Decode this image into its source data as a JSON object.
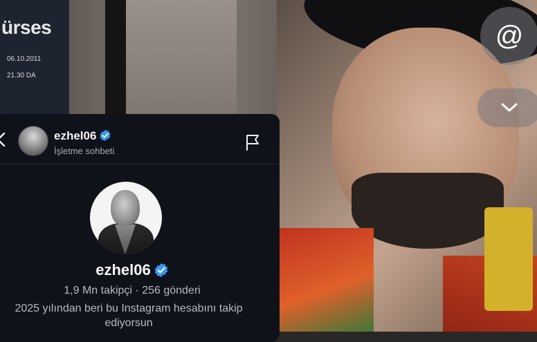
{
  "background": {
    "sign_text": "ürses",
    "sign_date": "06.10.2011",
    "sign_time": "21.30 DA"
  },
  "overlay_buttons": {
    "threads_icon": "threads-at-icon",
    "chevron_icon": "chevron-down-icon"
  },
  "dm": {
    "header": {
      "back_icon": "chevron-left-icon",
      "username": "ezhel06",
      "subtitle": "İşletme sohbeti",
      "flag_icon": "flag-icon"
    },
    "profile": {
      "username": "ezhel06",
      "stats": "1,9 Mn takipçi · 256 gönderi",
      "note": "2025 yılından beri bu Instagram hesabını takip ediyorsun"
    },
    "colors": {
      "panel_bg": "#0f1218",
      "verified_blue": "#3897f0"
    }
  }
}
